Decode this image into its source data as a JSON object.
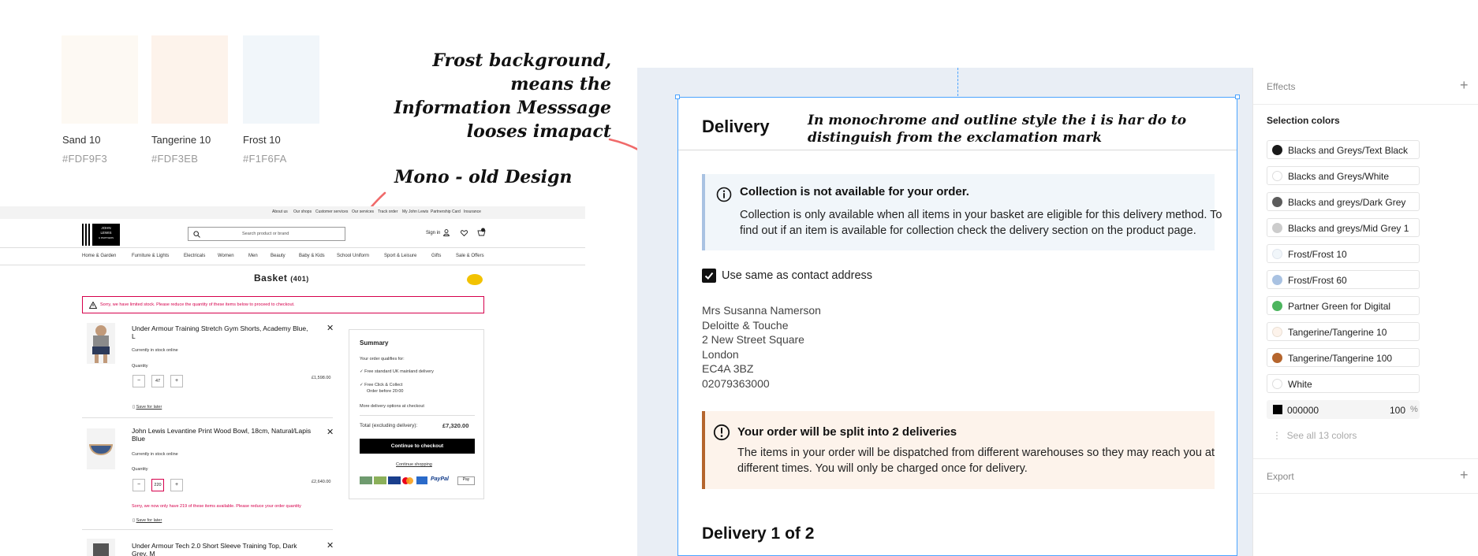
{
  "swatches": [
    {
      "name": "Sand 10",
      "hex": "#FDF9F3"
    },
    {
      "name": "Tangerine 10",
      "hex": "#FDF3EB"
    },
    {
      "name": "Frost 10",
      "hex": "#F1F6FA"
    }
  ],
  "annotations": {
    "frost_line1": "Frost background,",
    "frost_line2": "means the",
    "frost_line3": "Information Messsage",
    "frost_line4": "looses imapact",
    "mono": "Mono - old Design",
    "mono_line1": "In monochrome and outline style the i is har do to",
    "mono_line2": "distinguish from the exclamation mark"
  },
  "old_design": {
    "util_links": [
      "About us",
      "Our shops",
      "Customer services",
      "Our services",
      "Track order",
      "My John Lewis",
      "Partnership Card",
      "Insurance"
    ],
    "logo_line1": "JOHN",
    "logo_line2": "LEWIS",
    "logo_line3": "& PARTNERS",
    "search_placeholder": "Search product or brand",
    "sign_in": "Sign in",
    "nav": [
      "Home & Garden",
      "Furniture & Lights",
      "Electricals",
      "Women",
      "Men",
      "Beauty",
      "Baby & Kids",
      "School Uniform",
      "Sport & Leisure",
      "Gifts",
      "Sale & Offers"
    ],
    "basket_title": "Basket",
    "basket_count": "(401)",
    "warning": "Sorry, we have limited stock. Please reduce the quantity of these items below to proceed to checkout.",
    "items": [
      {
        "title": "Under Armour Training Stretch Gym Shorts, Academy Blue, L",
        "stock": "Currently in stock online",
        "qty_label": "Quantity",
        "qty": "47",
        "price": "£1,598.00",
        "save": "Save for later"
      },
      {
        "title": "John Lewis Levantine Print Wood Bowl, 18cm, Natural/Lapis Blue",
        "stock": "Currently in stock online",
        "qty_label": "Quantity",
        "qty": "220",
        "price": "£2,640.00",
        "error": "Sorry, we now only have 219 of these items available. Please reduce your order quantity",
        "save": "Save for later"
      },
      {
        "title": "Under Armour Tech 2.0 Short Sleeve Training Top, Dark Grey, M"
      }
    ],
    "summary": {
      "title": "Summary",
      "qualifies": "Your order qualifies for:",
      "opt1": "Free standard UK mainland delivery",
      "opt2a": "Free Click & Collect",
      "opt2b": "Order before 20:00",
      "more": "More delivery options at checkout",
      "total_label": "Total (excluding delivery):",
      "total": "£7,320.00",
      "checkout": "Continue to checkout",
      "continue": "Continue shopping"
    }
  },
  "delivery": {
    "title": "Delivery",
    "info_title": "Collection is not available for your order.",
    "info_line1": "Collection is only available when all items in your basket are eligible for this delivery method. To",
    "info_line2": "find out if an item is available for collection check the delivery section on the product page.",
    "checkbox_label": "Use same as contact address",
    "address": [
      "Mrs Susanna Namerson",
      "Deloitte & Touche",
      "2 New Street Square",
      "London",
      "EC4A 3BZ",
      "02079363000"
    ],
    "warn_title": "Your order will be split into 2 deliveries",
    "warn_line1": "The items in your order will be dispatched from different warehouses so they may reach you at",
    "warn_line2": "different times. You will only be charged once for delivery.",
    "delivery_heading": "Delivery 1 of 2"
  },
  "panel": {
    "effects": "Effects",
    "selection_colors": "Selection colors",
    "colors": [
      {
        "name": "Blacks and Greys/Text Black",
        "color": "#1a1a1a"
      },
      {
        "name": "Blacks and Greys/White",
        "color": "#ffffff"
      },
      {
        "name": "Blacks and greys/Dark Grey",
        "color": "#5c5c5c"
      },
      {
        "name": "Blacks and greys/Mid Grey 1",
        "color": "#cccccc"
      },
      {
        "name": "Frost/Frost 10",
        "color": "#f1f6fa"
      },
      {
        "name": "Frost/Frost 60",
        "color": "#a9c2e2"
      },
      {
        "name": "Partner Green for Digital",
        "color": "#4cb55e"
      },
      {
        "name": "Tangerine/Tangerine 10",
        "color": "#fdf3eb"
      },
      {
        "name": "Tangerine/Tangerine 100",
        "color": "#b5652d"
      },
      {
        "name": "White",
        "color": "#ffffff"
      }
    ],
    "hex_value": "000000",
    "opacity": "100",
    "percent": "%",
    "see_all": "See all 13 colors",
    "export": "Export"
  },
  "colors": {
    "sand10": "#FDF9F3",
    "tangerine10": "#FDF3EB",
    "frost10": "#F1F6FA",
    "arrow": "#f06a6a",
    "error_red": "#d6004c",
    "info_border": "#a9c2e2",
    "warn_border": "#b5652d",
    "selection_blue": "#4aa3ff"
  }
}
